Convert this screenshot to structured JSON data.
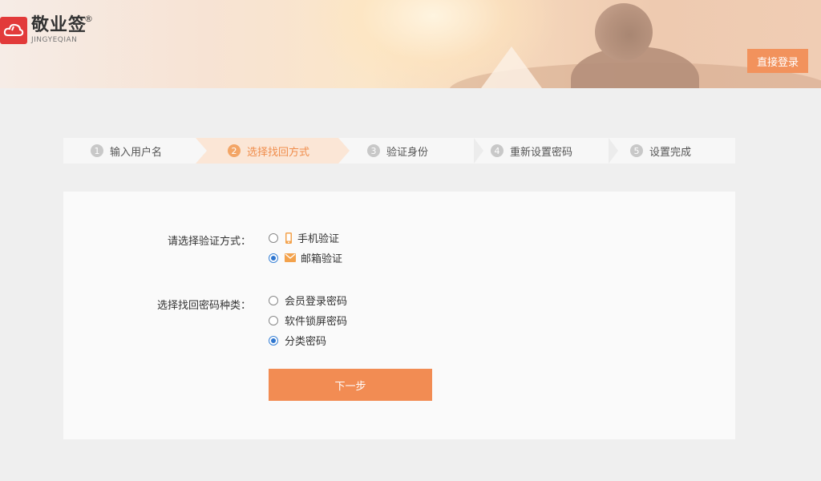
{
  "header": {
    "logo_cn": "敬业签",
    "logo_reg": "®",
    "logo_en": "JINGYEQIAN",
    "login_button": "直接登录"
  },
  "steps": [
    {
      "num": "1",
      "label": "输入用户名",
      "active": false
    },
    {
      "num": "2",
      "label": "选择找回方式",
      "active": true
    },
    {
      "num": "3",
      "label": "验证身份",
      "active": false
    },
    {
      "num": "4",
      "label": "重新设置密码",
      "active": false
    },
    {
      "num": "5",
      "label": "设置完成",
      "active": false
    }
  ],
  "form": {
    "verify_label": "请选择验证方式：",
    "verify_options": [
      {
        "label": "手机验证",
        "icon": "phone-icon",
        "selected": false
      },
      {
        "label": "邮箱验证",
        "icon": "mail-icon",
        "selected": true
      }
    ],
    "type_label": "选择找回密码种类：",
    "type_options": [
      {
        "label": "会员登录密码",
        "selected": false
      },
      {
        "label": "软件锁屏密码",
        "selected": false
      },
      {
        "label": "分类密码",
        "selected": true
      }
    ],
    "next_button": "下一步"
  },
  "colors": {
    "accent": "#f28c53",
    "logo_red": "#e23a3a",
    "radio_blue": "#2f76cf"
  }
}
